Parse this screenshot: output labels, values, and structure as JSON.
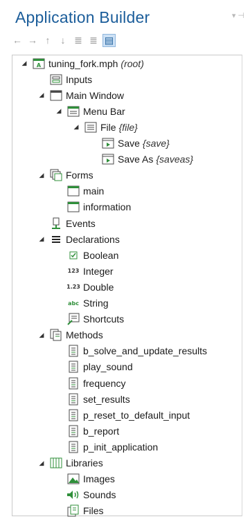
{
  "header": {
    "title": "Application Builder",
    "pin_glyph": "▾ ⊣"
  },
  "toolbar": [
    {
      "icon": "arrow-left-icon",
      "glyph": "←"
    },
    {
      "icon": "arrow-right-icon",
      "glyph": "→"
    },
    {
      "icon": "arrow-up-icon",
      "glyph": "↑"
    },
    {
      "icon": "arrow-down-icon",
      "glyph": "↓"
    },
    {
      "icon": "move-up-icon",
      "glyph": "≣"
    },
    {
      "icon": "move-down-icon",
      "glyph": "≣"
    },
    {
      "icon": "show-view-icon",
      "glyph": "▤"
    }
  ],
  "tree": [
    {
      "label": "tuning_fork.mph",
      "tag": "(root)",
      "icon": "app-root-icon",
      "expanded": true,
      "level": 0
    },
    {
      "label": "Inputs",
      "icon": "inputs-icon",
      "expanded": null,
      "level": 1
    },
    {
      "label": "Main Window",
      "icon": "window-icon",
      "expanded": true,
      "level": 1
    },
    {
      "label": "Menu Bar",
      "icon": "menu-bar-icon",
      "expanded": true,
      "level": 2
    },
    {
      "label": "File",
      "tag": "{file}",
      "icon": "menu-icon",
      "expanded": true,
      "level": 3
    },
    {
      "label": "Save",
      "tag": "{save}",
      "icon": "menu-item-icon",
      "expanded": null,
      "level": 4
    },
    {
      "label": "Save As",
      "tag": "{saveas}",
      "icon": "menu-item-icon",
      "expanded": null,
      "level": 4
    },
    {
      "label": "Forms",
      "icon": "forms-icon",
      "expanded": true,
      "level": 1
    },
    {
      "label": "main",
      "icon": "form-icon",
      "expanded": null,
      "level": 2
    },
    {
      "label": "information",
      "icon": "form-icon",
      "expanded": null,
      "level": 2
    },
    {
      "label": "Events",
      "icon": "events-icon",
      "expanded": null,
      "level": 1
    },
    {
      "label": "Declarations",
      "icon": "declarations-icon",
      "expanded": true,
      "level": 1
    },
    {
      "label": "Boolean",
      "icon": "boolean-icon",
      "expanded": null,
      "level": 2
    },
    {
      "label": "Integer",
      "icon": "integer-icon",
      "icon_text": "123",
      "expanded": null,
      "level": 2
    },
    {
      "label": "Double",
      "icon": "double-icon",
      "icon_text": "1.23",
      "expanded": null,
      "level": 2
    },
    {
      "label": "String",
      "icon": "string-icon",
      "icon_text": "abc",
      "expanded": null,
      "level": 2
    },
    {
      "label": "Shortcuts",
      "icon": "shortcuts-icon",
      "expanded": null,
      "level": 2
    },
    {
      "label": "Methods",
      "icon": "methods-icon",
      "expanded": true,
      "level": 1
    },
    {
      "label": "b_solve_and_update_results",
      "icon": "method-icon",
      "expanded": null,
      "level": 2
    },
    {
      "label": "play_sound",
      "icon": "method-icon",
      "expanded": null,
      "level": 2
    },
    {
      "label": "frequency",
      "icon": "method-icon",
      "expanded": null,
      "level": 2
    },
    {
      "label": "set_results",
      "icon": "method-icon",
      "expanded": null,
      "level": 2
    },
    {
      "label": "p_reset_to_default_input",
      "icon": "method-icon",
      "expanded": null,
      "level": 2
    },
    {
      "label": "b_report",
      "icon": "method-icon",
      "expanded": null,
      "level": 2
    },
    {
      "label": "p_init_application",
      "icon": "method-icon",
      "expanded": null,
      "level": 2
    },
    {
      "label": "Libraries",
      "icon": "libraries-icon",
      "expanded": true,
      "level": 1
    },
    {
      "label": "Images",
      "icon": "images-icon",
      "expanded": null,
      "level": 2
    },
    {
      "label": "Sounds",
      "icon": "sounds-icon",
      "expanded": null,
      "level": 2
    },
    {
      "label": "Files",
      "icon": "files-icon",
      "expanded": null,
      "level": 2
    }
  ],
  "colors": {
    "title": "#1b5d9a",
    "accent_green": "#2f8f3a",
    "frame": "#4a4a4a"
  }
}
